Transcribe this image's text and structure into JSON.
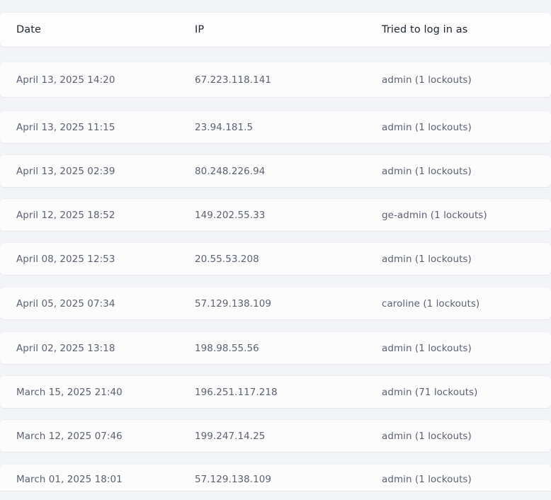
{
  "table": {
    "headers": {
      "date": "Date",
      "ip": "IP",
      "user": "Tried to log in as"
    },
    "rows": [
      {
        "date": "April 13, 2025 14:20",
        "ip": "67.223.118.141",
        "user": "admin (1 lockouts)"
      },
      {
        "date": "April 13, 2025 11:15",
        "ip": "23.94.181.5",
        "user": "admin (1 lockouts)"
      },
      {
        "date": "April 13, 2025 02:39",
        "ip": "80.248.226.94",
        "user": "admin (1 lockouts)"
      },
      {
        "date": "April 12, 2025 18:52",
        "ip": "149.202.55.33",
        "user": "ge-admin (1 lockouts)"
      },
      {
        "date": "April 08, 2025 12:53",
        "ip": "20.55.53.208",
        "user": "admin (1 lockouts)"
      },
      {
        "date": "April 05, 2025 07:34",
        "ip": "57.129.138.109",
        "user": "caroline (1 lockouts)"
      },
      {
        "date": "April 02, 2025 13:18",
        "ip": "198.98.55.56",
        "user": "admin (1 lockouts)"
      },
      {
        "date": "March 15, 2025 21:40",
        "ip": "196.251.117.218",
        "user": "admin (71 lockouts)"
      },
      {
        "date": "March 12, 2025 07:46",
        "ip": "199.247.14.25",
        "user": "admin (1 lockouts)"
      },
      {
        "date": "March 01, 2025 18:01",
        "ip": "57.129.138.109",
        "user": "admin (1 lockouts)"
      }
    ]
  },
  "colors": {
    "background": "#f3f4f7",
    "row_background": "#fcfcfd",
    "header_text": "#1e2432",
    "cell_text": "#5b6273"
  }
}
